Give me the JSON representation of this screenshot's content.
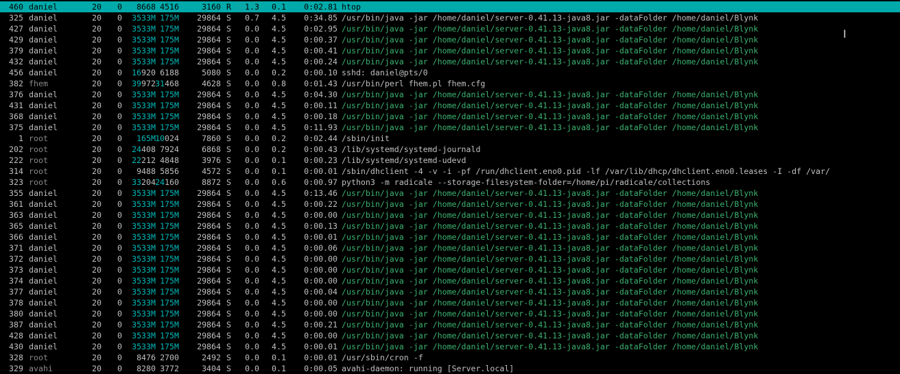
{
  "processes": [
    {
      "pid": "460",
      "user": "daniel",
      "pri": "20",
      "ni": "0",
      "virt_a": "",
      "virt_b": "8668",
      "res_a": "",
      "res_b": "4516",
      "shr_a": "",
      "shr_b": "3160",
      "s": "R",
      "cpu": "1.3",
      "mem": "0.1",
      "time": "0:02.81",
      "cmd_prog": "htop",
      "cmd_args": "",
      "selected": true,
      "user_dim": false,
      "cmd_colored": false
    },
    {
      "pid": "325",
      "user": "daniel",
      "pri": "20",
      "ni": "0",
      "virt_a": "3533M",
      "virt_b": "",
      "res_a": "175M",
      "res_b": "",
      "shr_a": "",
      "shr_b": "29864",
      "s": "S",
      "cpu": "0.7",
      "mem": "4.5",
      "time": "0:34.85",
      "cmd_prog": "/usr/bin/java",
      "cmd_args": " -jar /home/daniel/server-0.41.13-java8.jar -dataFolder /home/daniel/Blynk",
      "selected": false,
      "user_dim": false,
      "cmd_colored": false
    },
    {
      "pid": "427",
      "user": "daniel",
      "pri": "20",
      "ni": "0",
      "virt_a": "3533M",
      "virt_b": "",
      "res_a": "175M",
      "res_b": "",
      "shr_a": "",
      "shr_b": "29864",
      "s": "S",
      "cpu": "0.0",
      "mem": "4.5",
      "time": "0:02.95",
      "cmd_prog": "/usr/bin/java",
      "cmd_args": " -jar /home/daniel/server-0.41.13-java8.jar -dataFolder /home/daniel/Blynk",
      "selected": false,
      "user_dim": false,
      "cmd_colored": true
    },
    {
      "pid": "429",
      "user": "daniel",
      "pri": "20",
      "ni": "0",
      "virt_a": "3533M",
      "virt_b": "",
      "res_a": "175M",
      "res_b": "",
      "shr_a": "",
      "shr_b": "29864",
      "s": "S",
      "cpu": "0.0",
      "mem": "4.5",
      "time": "0:00.37",
      "cmd_prog": "/usr/bin/java",
      "cmd_args": " -jar /home/daniel/server-0.41.13-java8.jar -dataFolder /home/daniel/Blynk",
      "selected": false,
      "user_dim": false,
      "cmd_colored": true
    },
    {
      "pid": "379",
      "user": "daniel",
      "pri": "20",
      "ni": "0",
      "virt_a": "3533M",
      "virt_b": "",
      "res_a": "175M",
      "res_b": "",
      "shr_a": "",
      "shr_b": "29864",
      "s": "S",
      "cpu": "0.0",
      "mem": "4.5",
      "time": "0:00.41",
      "cmd_prog": "/usr/bin/java",
      "cmd_args": " -jar /home/daniel/server-0.41.13-java8.jar -dataFolder /home/daniel/Blynk",
      "selected": false,
      "user_dim": false,
      "cmd_colored": true
    },
    {
      "pid": "432",
      "user": "daniel",
      "pri": "20",
      "ni": "0",
      "virt_a": "3533M",
      "virt_b": "",
      "res_a": "175M",
      "res_b": "",
      "shr_a": "",
      "shr_b": "29864",
      "s": "S",
      "cpu": "0.0",
      "mem": "4.5",
      "time": "0:00.24",
      "cmd_prog": "/usr/bin/java",
      "cmd_args": " -jar /home/daniel/server-0.41.13-java8.jar -dataFolder /home/daniel/Blynk",
      "selected": false,
      "user_dim": false,
      "cmd_colored": true
    },
    {
      "pid": "456",
      "user": "daniel",
      "pri": "20",
      "ni": "0",
      "virt_a": "16",
      "virt_b": "920",
      "res_a": "",
      "res_b": "6188",
      "shr_a": "",
      "shr_b": "5080",
      "s": "S",
      "cpu": "0.0",
      "mem": "0.2",
      "time": "0:00.10",
      "cmd_prog": "sshd: daniel@pts/0",
      "cmd_args": "",
      "selected": false,
      "user_dim": false,
      "cmd_colored": false
    },
    {
      "pid": "382",
      "user": "fhem",
      "pri": "20",
      "ni": "0",
      "virt_a": "39",
      "virt_b": "972",
      "res_a": "31",
      "res_b": "468",
      "shr_a": "",
      "shr_b": "4628",
      "s": "S",
      "cpu": "0.0",
      "mem": "0.8",
      "time": "0:01.43",
      "cmd_prog": "/usr/bin/perl",
      "cmd_args": " fhem.pl fhem.cfg",
      "selected": false,
      "user_dim": true,
      "cmd_colored": false
    },
    {
      "pid": "376",
      "user": "daniel",
      "pri": "20",
      "ni": "0",
      "virt_a": "3533M",
      "virt_b": "",
      "res_a": "175M",
      "res_b": "",
      "shr_a": "",
      "shr_b": "29864",
      "s": "S",
      "cpu": "0.0",
      "mem": "4.5",
      "time": "0:04.30",
      "cmd_prog": "/usr/bin/java",
      "cmd_args": " -jar /home/daniel/server-0.41.13-java8.jar -dataFolder /home/daniel/Blynk",
      "selected": false,
      "user_dim": false,
      "cmd_colored": true
    },
    {
      "pid": "431",
      "user": "daniel",
      "pri": "20",
      "ni": "0",
      "virt_a": "3533M",
      "virt_b": "",
      "res_a": "175M",
      "res_b": "",
      "shr_a": "",
      "shr_b": "29864",
      "s": "S",
      "cpu": "0.0",
      "mem": "4.5",
      "time": "0:00.11",
      "cmd_prog": "/usr/bin/java",
      "cmd_args": " -jar /home/daniel/server-0.41.13-java8.jar -dataFolder /home/daniel/Blynk",
      "selected": false,
      "user_dim": false,
      "cmd_colored": true
    },
    {
      "pid": "368",
      "user": "daniel",
      "pri": "20",
      "ni": "0",
      "virt_a": "3533M",
      "virt_b": "",
      "res_a": "175M",
      "res_b": "",
      "shr_a": "",
      "shr_b": "29864",
      "s": "S",
      "cpu": "0.0",
      "mem": "4.5",
      "time": "0:00.18",
      "cmd_prog": "/usr/bin/java",
      "cmd_args": " -jar /home/daniel/server-0.41.13-java8.jar -dataFolder /home/daniel/Blynk",
      "selected": false,
      "user_dim": false,
      "cmd_colored": true
    },
    {
      "pid": "375",
      "user": "daniel",
      "pri": "20",
      "ni": "0",
      "virt_a": "3533M",
      "virt_b": "",
      "res_a": "175M",
      "res_b": "",
      "shr_a": "",
      "shr_b": "29864",
      "s": "S",
      "cpu": "0.0",
      "mem": "4.5",
      "time": "0:11.93",
      "cmd_prog": "/usr/bin/java",
      "cmd_args": " -jar /home/daniel/server-0.41.13-java8.jar -dataFolder /home/daniel/Blynk",
      "selected": false,
      "user_dim": false,
      "cmd_colored": true
    },
    {
      "pid": "1",
      "user": "root",
      "pri": "20",
      "ni": "0",
      "virt_a": "165M",
      "virt_b": "",
      "res_a": "10",
      "res_b": "024",
      "shr_a": "",
      "shr_b": "7860",
      "s": "S",
      "cpu": "0.0",
      "mem": "0.2",
      "time": "0:02.44",
      "cmd_prog": "/sbin/init",
      "cmd_args": "",
      "selected": false,
      "user_dim": true,
      "cmd_colored": false
    },
    {
      "pid": "202",
      "user": "root",
      "pri": "20",
      "ni": "0",
      "virt_a": "24",
      "virt_b": "408",
      "res_a": "",
      "res_b": "7924",
      "shr_a": "",
      "shr_b": "6868",
      "s": "S",
      "cpu": "0.0",
      "mem": "0.2",
      "time": "0:00.43",
      "cmd_prog": "/lib/systemd/systemd-journald",
      "cmd_args": "",
      "selected": false,
      "user_dim": true,
      "cmd_colored": false
    },
    {
      "pid": "222",
      "user": "root",
      "pri": "20",
      "ni": "0",
      "virt_a": "22",
      "virt_b": "212",
      "res_a": "",
      "res_b": "4848",
      "shr_a": "",
      "shr_b": "3976",
      "s": "S",
      "cpu": "0.0",
      "mem": "0.1",
      "time": "0:00.23",
      "cmd_prog": "/lib/systemd/systemd-udevd",
      "cmd_args": "",
      "selected": false,
      "user_dim": true,
      "cmd_colored": false
    },
    {
      "pid": "314",
      "user": "root",
      "pri": "20",
      "ni": "0",
      "virt_a": "",
      "virt_b": "9488",
      "res_a": "",
      "res_b": "5856",
      "shr_a": "",
      "shr_b": "4572",
      "s": "S",
      "cpu": "0.0",
      "mem": "0.1",
      "time": "0:00.01",
      "cmd_prog": "/sbin/dhclient",
      "cmd_args": " -4 -v -i -pf /run/dhclient.eno0.pid -lf /var/lib/dhcp/dhclient.eno0.leases -I -df /var/",
      "selected": false,
      "user_dim": true,
      "cmd_colored": false
    },
    {
      "pid": "323",
      "user": "root",
      "pri": "20",
      "ni": "0",
      "virt_a": "33",
      "virt_b": "204",
      "res_a": "24",
      "res_b": "160",
      "shr_a": "",
      "shr_b": "8872",
      "s": "S",
      "cpu": "0.0",
      "mem": "0.6",
      "time": "0:00.97",
      "cmd_prog": "python3",
      "cmd_args": " -m radicale --storage-filesystem-folder=/home/pi/radicale/collections",
      "selected": false,
      "user_dim": true,
      "cmd_colored": false
    },
    {
      "pid": "355",
      "user": "daniel",
      "pri": "20",
      "ni": "0",
      "virt_a": "3533M",
      "virt_b": "",
      "res_a": "175M",
      "res_b": "",
      "shr_a": "",
      "shr_b": "29864",
      "s": "S",
      "cpu": "0.0",
      "mem": "4.5",
      "time": "0:13.46",
      "cmd_prog": "/usr/bin/java",
      "cmd_args": " -jar /home/daniel/server-0.41.13-java8.jar -dataFolder /home/daniel/Blynk",
      "selected": false,
      "user_dim": false,
      "cmd_colored": true
    },
    {
      "pid": "361",
      "user": "daniel",
      "pri": "20",
      "ni": "0",
      "virt_a": "3533M",
      "virt_b": "",
      "res_a": "175M",
      "res_b": "",
      "shr_a": "",
      "shr_b": "29864",
      "s": "S",
      "cpu": "0.0",
      "mem": "4.5",
      "time": "0:00.22",
      "cmd_prog": "/usr/bin/java",
      "cmd_args": " -jar /home/daniel/server-0.41.13-java8.jar -dataFolder /home/daniel/Blynk",
      "selected": false,
      "user_dim": false,
      "cmd_colored": true
    },
    {
      "pid": "363",
      "user": "daniel",
      "pri": "20",
      "ni": "0",
      "virt_a": "3533M",
      "virt_b": "",
      "res_a": "175M",
      "res_b": "",
      "shr_a": "",
      "shr_b": "29864",
      "s": "S",
      "cpu": "0.0",
      "mem": "4.5",
      "time": "0:00.00",
      "cmd_prog": "/usr/bin/java",
      "cmd_args": " -jar /home/daniel/server-0.41.13-java8.jar -dataFolder /home/daniel/Blynk",
      "selected": false,
      "user_dim": false,
      "cmd_colored": true
    },
    {
      "pid": "365",
      "user": "daniel",
      "pri": "20",
      "ni": "0",
      "virt_a": "3533M",
      "virt_b": "",
      "res_a": "175M",
      "res_b": "",
      "shr_a": "",
      "shr_b": "29864",
      "s": "S",
      "cpu": "0.0",
      "mem": "4.5",
      "time": "0:00.13",
      "cmd_prog": "/usr/bin/java",
      "cmd_args": " -jar /home/daniel/server-0.41.13-java8.jar -dataFolder /home/daniel/Blynk",
      "selected": false,
      "user_dim": false,
      "cmd_colored": true
    },
    {
      "pid": "366",
      "user": "daniel",
      "pri": "20",
      "ni": "0",
      "virt_a": "3533M",
      "virt_b": "",
      "res_a": "175M",
      "res_b": "",
      "shr_a": "",
      "shr_b": "29864",
      "s": "S",
      "cpu": "0.0",
      "mem": "4.5",
      "time": "0:00.01",
      "cmd_prog": "/usr/bin/java",
      "cmd_args": " -jar /home/daniel/server-0.41.13-java8.jar -dataFolder /home/daniel/Blynk",
      "selected": false,
      "user_dim": false,
      "cmd_colored": true
    },
    {
      "pid": "371",
      "user": "daniel",
      "pri": "20",
      "ni": "0",
      "virt_a": "3533M",
      "virt_b": "",
      "res_a": "175M",
      "res_b": "",
      "shr_a": "",
      "shr_b": "29864",
      "s": "S",
      "cpu": "0.0",
      "mem": "4.5",
      "time": "0:00.06",
      "cmd_prog": "/usr/bin/java",
      "cmd_args": " -jar /home/daniel/server-0.41.13-java8.jar -dataFolder /home/daniel/Blynk",
      "selected": false,
      "user_dim": false,
      "cmd_colored": true
    },
    {
      "pid": "372",
      "user": "daniel",
      "pri": "20",
      "ni": "0",
      "virt_a": "3533M",
      "virt_b": "",
      "res_a": "175M",
      "res_b": "",
      "shr_a": "",
      "shr_b": "29864",
      "s": "S",
      "cpu": "0.0",
      "mem": "4.5",
      "time": "0:00.00",
      "cmd_prog": "/usr/bin/java",
      "cmd_args": " -jar /home/daniel/server-0.41.13-java8.jar -dataFolder /home/daniel/Blynk",
      "selected": false,
      "user_dim": false,
      "cmd_colored": true
    },
    {
      "pid": "373",
      "user": "daniel",
      "pri": "20",
      "ni": "0",
      "virt_a": "3533M",
      "virt_b": "",
      "res_a": "175M",
      "res_b": "",
      "shr_a": "",
      "shr_b": "29864",
      "s": "S",
      "cpu": "0.0",
      "mem": "4.5",
      "time": "0:00.00",
      "cmd_prog": "/usr/bin/java",
      "cmd_args": " -jar /home/daniel/server-0.41.13-java8.jar -dataFolder /home/daniel/Blynk",
      "selected": false,
      "user_dim": false,
      "cmd_colored": true
    },
    {
      "pid": "374",
      "user": "daniel",
      "pri": "20",
      "ni": "0",
      "virt_a": "3533M",
      "virt_b": "",
      "res_a": "175M",
      "res_b": "",
      "shr_a": "",
      "shr_b": "29864",
      "s": "S",
      "cpu": "0.0",
      "mem": "4.5",
      "time": "0:00.00",
      "cmd_prog": "/usr/bin/java",
      "cmd_args": " -jar /home/daniel/server-0.41.13-java8.jar -dataFolder /home/daniel/Blynk",
      "selected": false,
      "user_dim": false,
      "cmd_colored": true
    },
    {
      "pid": "377",
      "user": "daniel",
      "pri": "20",
      "ni": "0",
      "virt_a": "3533M",
      "virt_b": "",
      "res_a": "175M",
      "res_b": "",
      "shr_a": "",
      "shr_b": "29864",
      "s": "S",
      "cpu": "0.0",
      "mem": "4.5",
      "time": "0:00.04",
      "cmd_prog": "/usr/bin/java",
      "cmd_args": " -jar /home/daniel/server-0.41.13-java8.jar -dataFolder /home/daniel/Blynk",
      "selected": false,
      "user_dim": false,
      "cmd_colored": true
    },
    {
      "pid": "378",
      "user": "daniel",
      "pri": "20",
      "ni": "0",
      "virt_a": "3533M",
      "virt_b": "",
      "res_a": "175M",
      "res_b": "",
      "shr_a": "",
      "shr_b": "29864",
      "s": "S",
      "cpu": "0.0",
      "mem": "4.5",
      "time": "0:00.00",
      "cmd_prog": "/usr/bin/java",
      "cmd_args": " -jar /home/daniel/server-0.41.13-java8.jar -dataFolder /home/daniel/Blynk",
      "selected": false,
      "user_dim": false,
      "cmd_colored": true
    },
    {
      "pid": "380",
      "user": "daniel",
      "pri": "20",
      "ni": "0",
      "virt_a": "3533M",
      "virt_b": "",
      "res_a": "175M",
      "res_b": "",
      "shr_a": "",
      "shr_b": "29864",
      "s": "S",
      "cpu": "0.0",
      "mem": "4.5",
      "time": "0:00.00",
      "cmd_prog": "/usr/bin/java",
      "cmd_args": " -jar /home/daniel/server-0.41.13-java8.jar -dataFolder /home/daniel/Blynk",
      "selected": false,
      "user_dim": false,
      "cmd_colored": true
    },
    {
      "pid": "387",
      "user": "daniel",
      "pri": "20",
      "ni": "0",
      "virt_a": "3533M",
      "virt_b": "",
      "res_a": "175M",
      "res_b": "",
      "shr_a": "",
      "shr_b": "29864",
      "s": "S",
      "cpu": "0.0",
      "mem": "4.5",
      "time": "0:00.21",
      "cmd_prog": "/usr/bin/java",
      "cmd_args": " -jar /home/daniel/server-0.41.13-java8.jar -dataFolder /home/daniel/Blynk",
      "selected": false,
      "user_dim": false,
      "cmd_colored": true
    },
    {
      "pid": "428",
      "user": "daniel",
      "pri": "20",
      "ni": "0",
      "virt_a": "3533M",
      "virt_b": "",
      "res_a": "175M",
      "res_b": "",
      "shr_a": "",
      "shr_b": "29864",
      "s": "S",
      "cpu": "0.0",
      "mem": "4.5",
      "time": "0:00.00",
      "cmd_prog": "/usr/bin/java",
      "cmd_args": " -jar /home/daniel/server-0.41.13-java8.jar -dataFolder /home/daniel/Blynk",
      "selected": false,
      "user_dim": false,
      "cmd_colored": true
    },
    {
      "pid": "430",
      "user": "daniel",
      "pri": "20",
      "ni": "0",
      "virt_a": "3533M",
      "virt_b": "",
      "res_a": "175M",
      "res_b": "",
      "shr_a": "",
      "shr_b": "29864",
      "s": "S",
      "cpu": "0.0",
      "mem": "4.5",
      "time": "0:00.01",
      "cmd_prog": "/usr/bin/java",
      "cmd_args": " -jar /home/daniel/server-0.41.13-java8.jar -dataFolder /home/daniel/Blynk",
      "selected": false,
      "user_dim": false,
      "cmd_colored": true
    },
    {
      "pid": "328",
      "user": "root",
      "pri": "20",
      "ni": "0",
      "virt_a": "",
      "virt_b": "8476",
      "res_a": "",
      "res_b": "2700",
      "shr_a": "",
      "shr_b": "2492",
      "s": "S",
      "cpu": "0.0",
      "mem": "0.1",
      "time": "0:00.01",
      "cmd_prog": "/usr/sbin/cron",
      "cmd_args": " -f",
      "selected": false,
      "user_dim": true,
      "cmd_colored": false
    },
    {
      "pid": "329",
      "user": "avahi",
      "pri": "20",
      "ni": "0",
      "virt_a": "",
      "virt_b": "8280",
      "res_a": "",
      "res_b": "3772",
      "shr_a": "",
      "shr_b": "3404",
      "s": "S",
      "cpu": "0.0",
      "mem": "0.1",
      "time": "0:00.05",
      "cmd_prog": "avahi-daemon: running [Server.local]",
      "cmd_args": "",
      "selected": false,
      "user_dim": true,
      "cmd_colored": false
    }
  ],
  "colors": {
    "background": "#000000",
    "text": "#c0c0c0",
    "selection": "#00aaaa",
    "thread_green": "#3cb371",
    "size_cyan": "#00b8b8",
    "dim_user": "#8a8a8a"
  },
  "cursor_icon": "text-cursor-icon"
}
